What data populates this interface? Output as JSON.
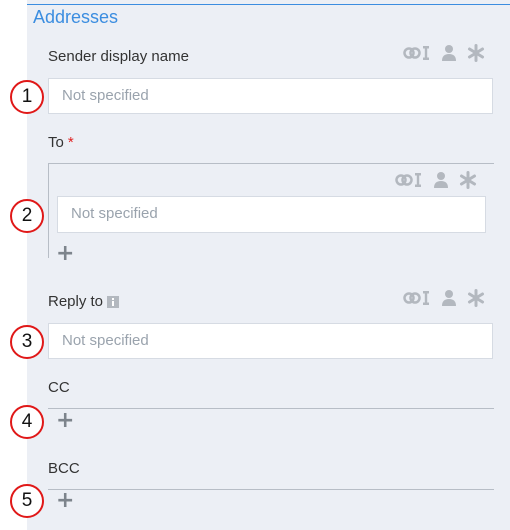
{
  "section": {
    "title": "Addresses"
  },
  "callouts": [
    "1",
    "2",
    "3",
    "4",
    "5"
  ],
  "sender": {
    "label": "Sender display name",
    "placeholder": "Not specified"
  },
  "to": {
    "label": "To",
    "required_mark": "*",
    "placeholder": "Not specified"
  },
  "reply_to": {
    "label": "Reply to",
    "placeholder": "Not specified"
  },
  "cc": {
    "label": "CC"
  },
  "bcc": {
    "label": "BCC"
  },
  "icons": {
    "field_actions": [
      "link-text-icon",
      "user-icon",
      "asterisk-icon"
    ],
    "add": "plus-icon",
    "info": "info-icon"
  },
  "colors": {
    "accent": "#3b8de0",
    "required": "#e02020",
    "callout": "#e01818",
    "icon": "#b3b8bf"
  }
}
